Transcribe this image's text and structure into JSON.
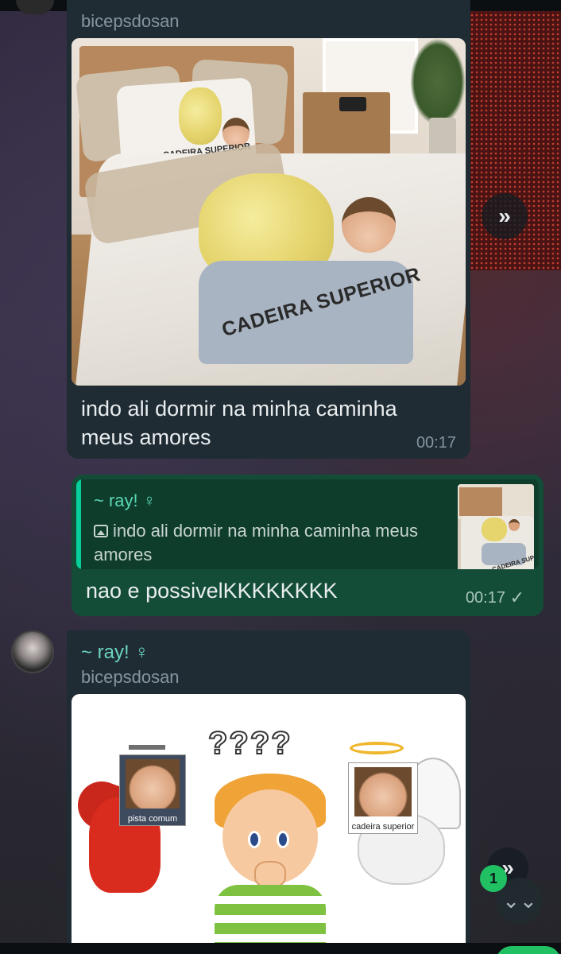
{
  "messages": {
    "first": {
      "sender_handle": "bicepsdosan",
      "image_print_text_big": "CADEIRA SUPERIOR",
      "image_print_text_small": "CADEIRA SUPERIOR",
      "text": "indo ali dormir na minha caminha meus amores",
      "time": "00:17"
    },
    "reply": {
      "quoted_author": "~ ray! ♀",
      "quoted_text": "indo ali dormir na minha caminha meus amores",
      "thumb_text": "CADEIRA SUPERIOR",
      "text": "nao e possivelKKKKKKKK",
      "time": "00:17",
      "status_icon": "✓"
    },
    "second": {
      "sender_name": "~ ray! ♀",
      "sender_handle": "bicepsdosan",
      "question_marks": "????",
      "card_left_label": "pista comum",
      "card_right_label": "cadeira superior"
    }
  },
  "controls": {
    "forward_icon": "»",
    "unread_badge": "1",
    "scroll_down_icon": "⌄⌄"
  },
  "colors": {
    "incoming_bubble": "#1f2c33",
    "outgoing_bubble": "#134d37",
    "accent": "#21c063"
  }
}
